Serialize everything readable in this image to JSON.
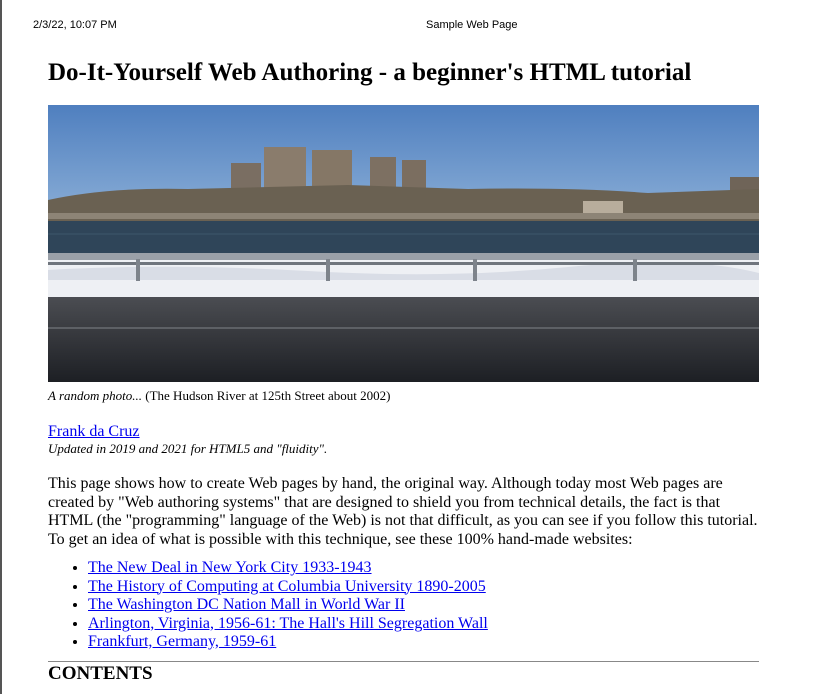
{
  "header": {
    "timestamp": "2/3/22, 10:07 PM",
    "page_label": "Sample Web Page"
  },
  "article": {
    "title": "Do-It-Yourself Web Authoring - a beginner's HTML tutorial",
    "photo": {
      "caption_italic": "A random photo...",
      "caption_rest": " (The Hudson River at 125th Street about 2002)"
    },
    "author_link": "Frank da Cruz",
    "updated_note": "Updated in 2019 and 2021 for HTML5 and \"fluidity\".",
    "intro": "This page shows how to create Web pages by hand, the original way. Although today most Web pages are created by \"Web authoring systems\" that are designed to shield you from technical details, the fact is that HTML (the \"programming\" language of the Web) is not that difficult, as you can see if you follow this tutorial. To get an idea of what is possible with this technique, see these 100% hand-made websites:",
    "links": [
      "The New Deal in New York City 1933-1943",
      "The History of Computing at Columbia University 1890-2005",
      "The Washington DC Nation Mall in World War II",
      "Arlington, Virginia, 1956-61: The Hall's Hill Segregation Wall",
      "Frankfurt, Germany, 1959-61"
    ],
    "contents_heading": "CONTENTS"
  },
  "colors": {
    "link": "#0000ee",
    "sky": "#5d8cc4",
    "river": "#2f4559",
    "snow": "#eef0f4",
    "road": "#3a3c40"
  }
}
